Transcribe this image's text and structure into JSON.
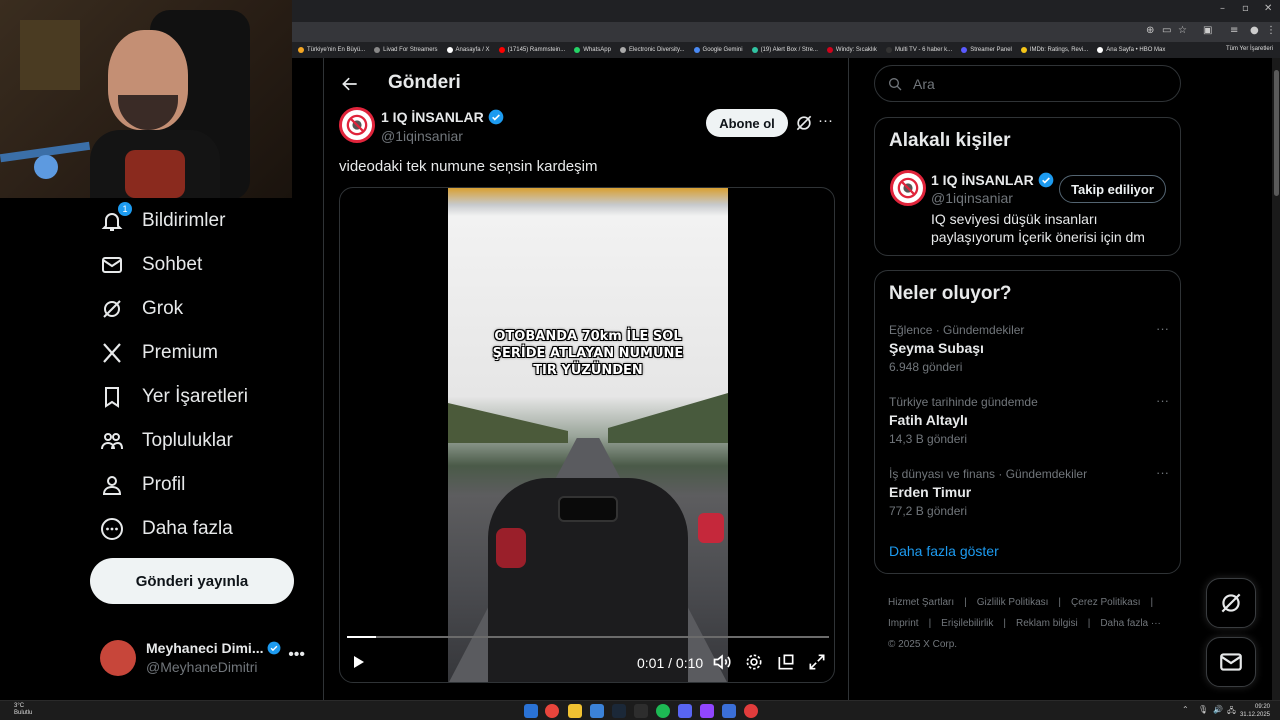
{
  "browser": {
    "bookmarks": [
      {
        "label": "Türkiye'nin En Büyü...",
        "color": "#f5a623"
      },
      {
        "label": "Livad For Streamers",
        "color": "#888888"
      },
      {
        "label": "Anasayfa / X",
        "color": "#ffffff"
      },
      {
        "label": "(17145) Rammstein...",
        "color": "#ff0000"
      },
      {
        "label": "WhatsApp",
        "color": "#25d366"
      },
      {
        "label": "Electronic Diversity...",
        "color": "#aaaaaa"
      },
      {
        "label": "Google Gemini",
        "color": "#4a8af4"
      },
      {
        "label": "(19) Alert Box / Stre...",
        "color": "#31c3a2"
      },
      {
        "label": "Windy: Sıcaklık",
        "color": "#d0021b"
      },
      {
        "label": "Multi TV - 6 haber k...",
        "color": "#333333"
      },
      {
        "label": "Streamer Panel",
        "color": "#5a5aff"
      },
      {
        "label": "IMDb: Ratings, Revi...",
        "color": "#f5c518"
      },
      {
        "label": "Ana Sayfa • HBO Max",
        "color": "#ffffff"
      }
    ],
    "all_bookmarks": "Tüm Yer İşaretleri"
  },
  "sidebar": {
    "items": [
      {
        "label": "Bildirimler",
        "icon": "bell-icon",
        "badge": "1"
      },
      {
        "label": "Sohbet",
        "icon": "mail-icon"
      },
      {
        "label": "Grok",
        "icon": "grok-icon"
      },
      {
        "label": "Premium",
        "icon": "x-logo-icon"
      },
      {
        "label": "Yer İşaretleri",
        "icon": "bookmark-icon"
      },
      {
        "label": "Topluluklar",
        "icon": "communities-icon"
      },
      {
        "label": "Profil",
        "icon": "person-icon"
      },
      {
        "label": "Daha fazla",
        "icon": "more-circle-icon"
      }
    ],
    "post_button": "Gönderi yayınla",
    "account": {
      "name": "Meyhaneci Dimi...",
      "handle": "@MeyhaneDimitri"
    }
  },
  "post": {
    "page_title": "Gönderi",
    "author_name": "1 IQ İNSANLAR",
    "author_handle": "@1iqinsaniar",
    "follow_label": "Abone ol",
    "text": "videodaki tek numune seņsin kardeşim",
    "video_caption": [
      "OTOBANDA 70km İLE SOL",
      "ŞERİDE ATLAYAN NUMUNE",
      "TIR YÜZÜNDEN"
    ],
    "time": "0:01 / 0:10",
    "progress": 0.06
  },
  "right": {
    "search_placeholder": "Ara",
    "related_title": "Alakalı kişiler",
    "related": {
      "name": "1 IQ İNSANLAR",
      "handle": "@1iqinsaniar",
      "button": "Takip ediliyor",
      "bio": "IQ seviyesi düşük insanları paylaşıyorum İçerik önerisi için dm"
    },
    "trends_title": "Neler oluyor?",
    "trends": [
      {
        "context": "Eğlence · Gündemdekiler",
        "topic": "Şeyma Subaşı",
        "count": "6.948 gönderi"
      },
      {
        "context": "Türkiye tarihinde gündemde",
        "topic": "Fatih Altaylı",
        "count": "14,3 B gönderi"
      },
      {
        "context": "İş dünyası ve finans · Gündemdekiler",
        "topic": "Erden Timur",
        "count": "77,2 B gönderi"
      }
    ],
    "show_more": "Daha fazla göster",
    "footer": {
      "line1": [
        "Hizmet Şartları",
        "|",
        "Gizlilik Politikası",
        "|",
        "Çerez Politikası",
        "|"
      ],
      "line2": [
        "Imprint",
        "|",
        "Erişilebilirlik",
        "|",
        "Reklam bilgisi",
        "|",
        "Daha fazla ···"
      ],
      "copyright": "© 2025 X Corp."
    }
  },
  "taskbar": {
    "weather_temp": "3°C",
    "weather_desc": "Bulutlu",
    "time": "09:20",
    "date": "31.12.2025"
  }
}
